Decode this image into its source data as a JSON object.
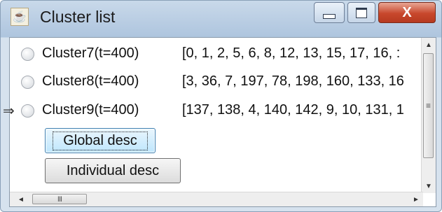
{
  "window": {
    "title": "Cluster list",
    "app_icon": "java-cup-icon",
    "controls": {
      "minimize": "minimize-icon",
      "maximize": "maximize-icon",
      "close_glyph": "X"
    }
  },
  "clusters": [
    {
      "name": "Cluster7(t=400)",
      "members": "[0, 1, 2, 5, 6, 8, 12, 13, 15, 17, 16, :",
      "selected": false
    },
    {
      "name": "Cluster8(t=400)",
      "members": "[3, 36, 7, 197, 78, 198, 160, 133, 16",
      "selected": false
    },
    {
      "name": "Cluster9(t=400)",
      "members": "[137, 138, 4, 140, 142, 9, 10, 131, 1",
      "selected": false
    }
  ],
  "buttons": {
    "global_desc": "Global desc",
    "individual_desc": "Individual desc"
  },
  "scrollbars": {
    "vertical": {
      "up": "▲",
      "down": "▼",
      "grip": "≡"
    },
    "horizontal": {
      "left": "◄",
      "right": "►",
      "grip": "III"
    }
  }
}
